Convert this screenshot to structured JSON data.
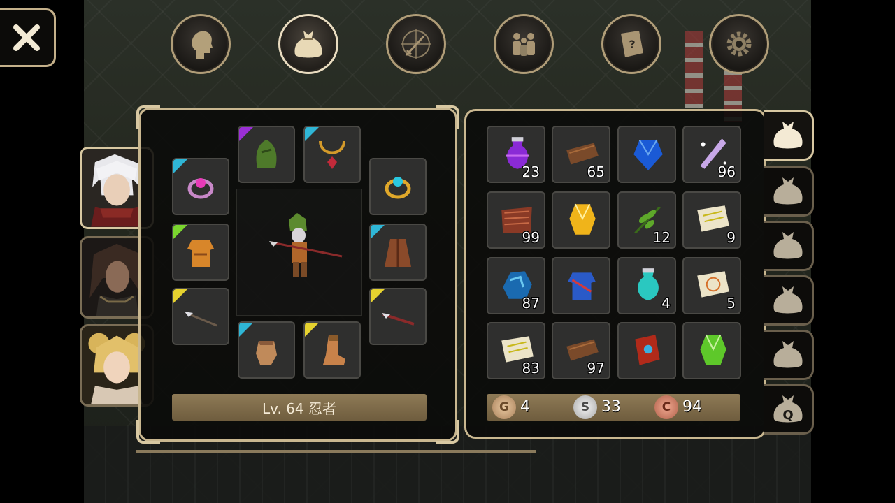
{
  "close_button": {
    "icon": "close-icon"
  },
  "top_nav": [
    {
      "name": "profile",
      "icon": "head-icon",
      "active": false
    },
    {
      "name": "bag",
      "icon": "bag-icon",
      "active": true
    },
    {
      "name": "skills",
      "icon": "sword-compass-icon",
      "active": false
    },
    {
      "name": "party",
      "icon": "party-icon",
      "active": false
    },
    {
      "name": "quests",
      "icon": "quest-scroll-icon",
      "active": false
    },
    {
      "name": "settings",
      "icon": "gear-icon",
      "active": false
    }
  ],
  "characters": [
    {
      "name": "white-haired-hero",
      "active": true
    },
    {
      "name": "dark-haired-warrior",
      "active": false
    },
    {
      "name": "blonde-mage",
      "active": false
    }
  ],
  "equipment": {
    "class_label": "Lv. 64 忍者",
    "slots": [
      {
        "slot": "helmet",
        "icon": "green-hood-icon",
        "rarity_color": "#9b2fd6"
      },
      {
        "slot": "necklace",
        "icon": "ruby-necklace-icon",
        "rarity_color": "#2fb6d6"
      },
      {
        "slot": "ring-left",
        "icon": "pink-ring-icon",
        "rarity_color": "#2fb6d6"
      },
      {
        "slot": "ring-right",
        "icon": "gold-ring-icon",
        "rarity_color": ""
      },
      {
        "slot": "armor",
        "icon": "orange-armor-icon",
        "rarity_color": "#7bd62f"
      },
      {
        "slot": "cloak",
        "icon": "brown-cloak-icon",
        "rarity_color": "#2fb6d6"
      },
      {
        "slot": "main-weapon",
        "icon": "spear-icon",
        "rarity_color": "#e6d22f"
      },
      {
        "slot": "off-weapon",
        "icon": "red-spear-icon",
        "rarity_color": "#e6d22f"
      },
      {
        "slot": "gloves",
        "icon": "gloves-icon",
        "rarity_color": "#2fb6d6"
      },
      {
        "slot": "boots",
        "icon": "boots-icon",
        "rarity_color": "#e6d22f"
      }
    ]
  },
  "inventory": {
    "items": [
      {
        "icon": "purple-potion-icon",
        "qty": "23"
      },
      {
        "icon": "leather-icon",
        "qty": "65"
      },
      {
        "icon": "blue-gem-icon",
        "qty": ""
      },
      {
        "icon": "crystal-feather-icon",
        "qty": "96"
      },
      {
        "icon": "fur-pelt-icon",
        "qty": "99"
      },
      {
        "icon": "yellow-gem-icon",
        "qty": ""
      },
      {
        "icon": "herb-leaf-icon",
        "qty": "12"
      },
      {
        "icon": "yellow-scroll-icon",
        "qty": "9"
      },
      {
        "icon": "blue-ore-icon",
        "qty": "87"
      },
      {
        "icon": "blue-armor-icon",
        "qty": ""
      },
      {
        "icon": "cyan-potion-icon",
        "qty": "4"
      },
      {
        "icon": "magic-scroll-icon",
        "qty": "5"
      },
      {
        "icon": "yellow-scroll-icon",
        "qty": "83"
      },
      {
        "icon": "leather-icon",
        "qty": "97"
      },
      {
        "icon": "red-book-icon",
        "qty": ""
      },
      {
        "icon": "green-gem-icon",
        "qty": ""
      }
    ],
    "currency": {
      "gold": {
        "symbol": "G",
        "value": "4"
      },
      "silver": {
        "symbol": "S",
        "value": "33"
      },
      "copper": {
        "symbol": "C",
        "value": "94"
      }
    }
  },
  "bag_tabs": [
    {
      "icon": "bag-icon",
      "label": "",
      "active": true
    },
    {
      "icon": "bag-icon",
      "label": "",
      "active": false
    },
    {
      "icon": "bag-icon",
      "label": "",
      "active": false
    },
    {
      "icon": "bag-icon",
      "label": "",
      "active": false
    },
    {
      "icon": "bag-icon",
      "label": "",
      "active": false
    },
    {
      "icon": "quest-bag-icon",
      "label": "Q",
      "active": false
    }
  ]
}
